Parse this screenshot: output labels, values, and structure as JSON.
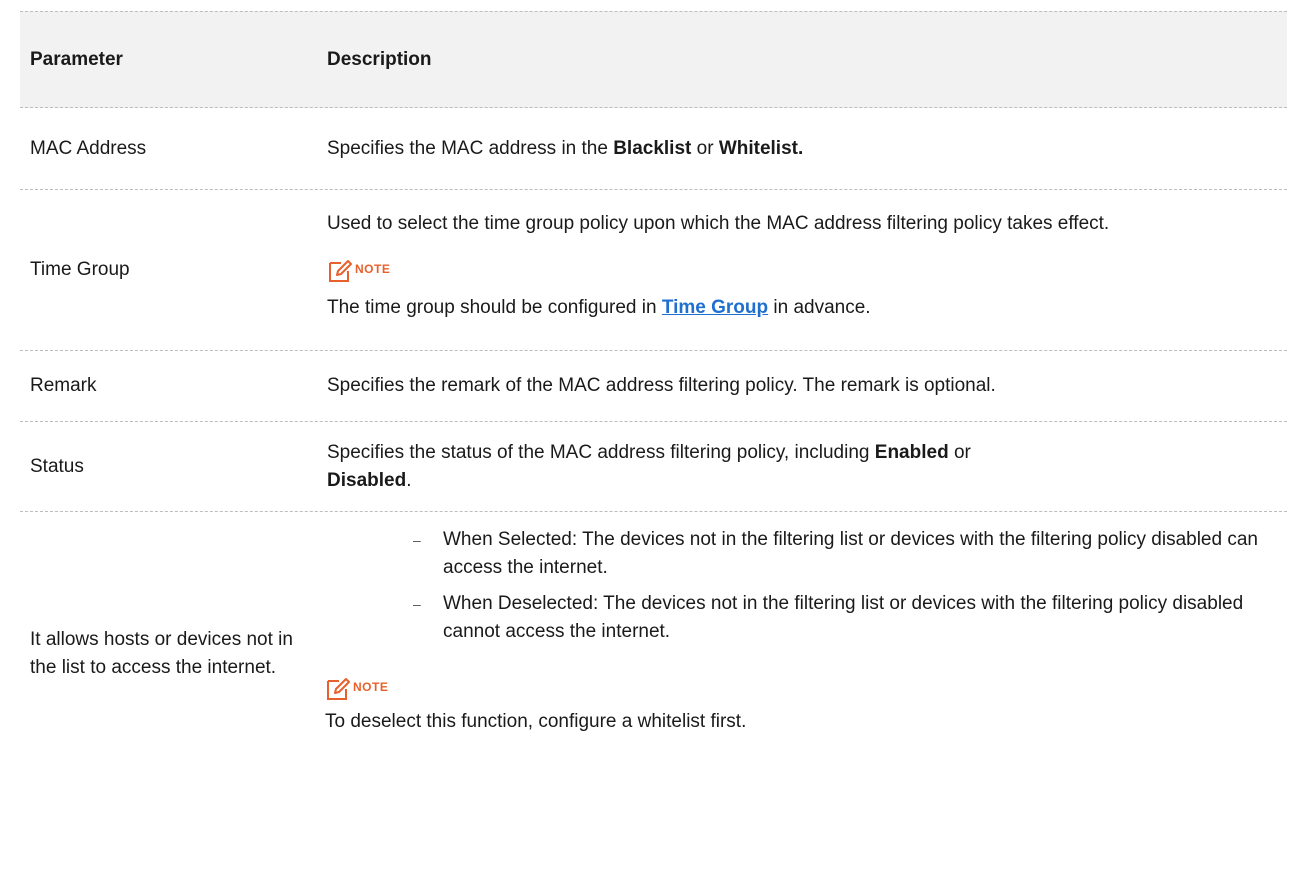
{
  "table": {
    "header": {
      "param": "Parameter",
      "desc": "Description"
    },
    "mac": {
      "param": "MAC Address",
      "desc_pre": "Specifies the MAC address in the ",
      "blacklist": "Blacklist",
      "or": " or ",
      "whitelist": "Whitelist."
    },
    "timegroup": {
      "param": "Time Group",
      "desc": "Used to select the time group policy upon which the MAC address filtering policy takes effect.",
      "note_label": "NOTE",
      "note_pre": "The time group should be configured in ",
      "note_link": "Time Group",
      "note_post": " in advance."
    },
    "remark": {
      "param": "Remark",
      "desc": "Specifies the remark of the MAC address filtering policy. The remark is optional."
    },
    "status": {
      "param": "Status",
      "desc_pre": "Specifies the status of the MAC address filtering policy, including ",
      "enabled": "Enabled",
      "or": " or ",
      "disabled": "Disabled",
      "end": "."
    },
    "allow": {
      "param": "It allows hosts or devices not in the list to access the internet.",
      "bullets": [
        "When Selected: The devices not in the filtering list or devices with the filtering policy disabled can access the internet.",
        "When Deselected: The devices not in the filtering list or devices with the filtering policy disabled cannot access the internet."
      ],
      "bullet_mark": "–",
      "note_label": "NOTE",
      "note_text": "To deselect this function, configure a whitelist first."
    }
  },
  "colors": {
    "note": "#e8612c",
    "link": "#1f6fd1",
    "header_bg": "#f2f2f2"
  }
}
